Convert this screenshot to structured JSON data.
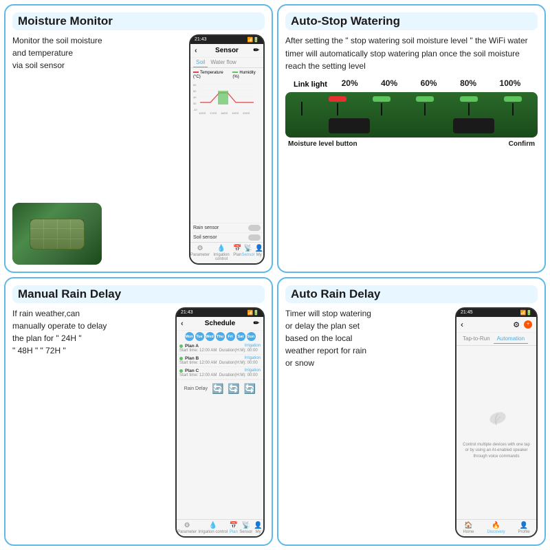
{
  "cards": {
    "moisture_monitor": {
      "title": "Moisture Monitor",
      "description": "Monitor the soil moisture\nand temperature\nvia soil sensor",
      "phone": {
        "status_bar": "21:43",
        "header_title": "Sensor",
        "tabs": [
          "Soil",
          "Water flow"
        ],
        "chart_legend": [
          "Temperature (°C)",
          "Humidity (%)"
        ],
        "dates": [
          "12/03",
          "17/03",
          "18/03",
          "19/03",
          "20/03"
        ],
        "sensors": [
          "Rain sensor",
          "Soil sensor"
        ],
        "nav_items": [
          "Parameter",
          "Irrigation control",
          "Plan",
          "Sensor",
          "My"
        ]
      }
    },
    "auto_stop": {
      "title": "Auto-Stop Watering",
      "description": "After setting the \" stop watering soil moisture level \" the WiFi water timer will automatically stop watering plan once the soil moisture reach the setting level",
      "link_light": "Link light",
      "pct_labels": [
        "20%",
        "40%",
        "60%",
        "80%",
        "100%"
      ],
      "bottom_labels": [
        "Moisture level button",
        "Confirm"
      ]
    },
    "manual_rain": {
      "title": "Manual Rain Delay",
      "description": "If rain weather,can\nmanually operate to delay\nthe plan for \" 24H \"\n\" 48H \" \" 72H \"",
      "phone": {
        "status_bar": "21:43",
        "header_title": "Schedule",
        "days": [
          "Mon",
          "Tue",
          "Wed",
          "Thu",
          "Fri",
          "Sat",
          "Sun"
        ],
        "plans": [
          {
            "name": "Plan A",
            "type": "Irrigation",
            "time": "Start time: 12:00 AM",
            "duration": "Duration(H:M): 00:00"
          },
          {
            "name": "Plan B",
            "type": "Irrigation",
            "time": "Start time: 12:00 AM",
            "duration": "Duration(H:M): 00:00"
          },
          {
            "name": "Plan C",
            "type": "Irrigation",
            "time": "Start time: 12:00 AM",
            "duration": "Duration(H:M): 00:00"
          }
        ],
        "rain_delay_label": "Rain Delay",
        "nav_items": [
          "Parameter",
          "Irrigation control",
          "Plan",
          "Sensor",
          "My"
        ]
      }
    },
    "auto_rain": {
      "title": "Auto Rain Delay",
      "description": "Timer will stop watering\nor delay the plan set\nbased on the local\nweather report for rain\nor snow",
      "phone": {
        "status_bar": "21:45",
        "tabs": [
          "Tap-to-Run",
          "Automation"
        ],
        "auto_description": "Control multiple devices with one tap or by using an AI-enabled speaker through voice commands",
        "nav_items": [
          "Home",
          "Discovery",
          "Profile"
        ]
      }
    }
  }
}
